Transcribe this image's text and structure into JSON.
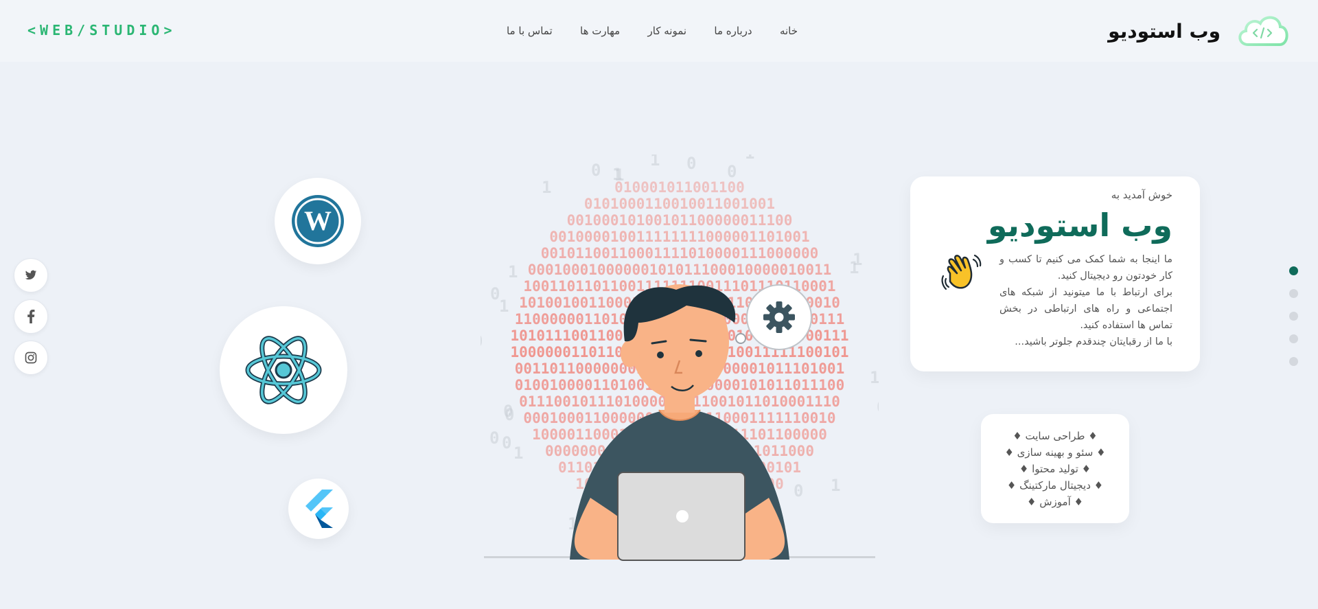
{
  "header": {
    "brand_name": "وب استودیو",
    "studio_tag": "<WEB/STUDIO>",
    "nav": [
      {
        "label": "خانه"
      },
      {
        "label": "درباره ما"
      },
      {
        "label": "نمونه کار"
      },
      {
        "label": "مهارت ها"
      },
      {
        "label": "تماس با ما"
      }
    ]
  },
  "social": [
    {
      "icon": "twitter-icon"
    },
    {
      "icon": "facebook-icon"
    },
    {
      "icon": "instagram-icon"
    }
  ],
  "tech_icons": [
    "wordpress-icon",
    "react-icon",
    "flutter-icon"
  ],
  "welcome_card": {
    "welcome": "خوش آمدید به",
    "title": "وب استودیو",
    "line1": "ما اینجا به شما کمک می کنیم تا کسب و کار خودتون رو دیجیتال کنید.",
    "line2": "برای ارتباط با ما میتونید از شبکه های اجتماعی و راه های ارتباطی در بخش تماس ها استفاده کنید.",
    "line3": "با ما از رقبایتان چندقدم جلوتر باشید..."
  },
  "services": [
    "♦ طراحی سایت ♦",
    "♦ سئو و بهینه سازی ♦",
    "♦ تولید محتوا ♦",
    "♦ دیجیتال مارکتینگ ♦",
    "♦ آموزش ♦"
  ],
  "pager": {
    "count": 5,
    "active_index": 0
  },
  "colors": {
    "accent": "#0f6b5a",
    "tag_green": "#2bb673",
    "background": "#edf1f7",
    "binary_red": "#f0766b"
  }
}
